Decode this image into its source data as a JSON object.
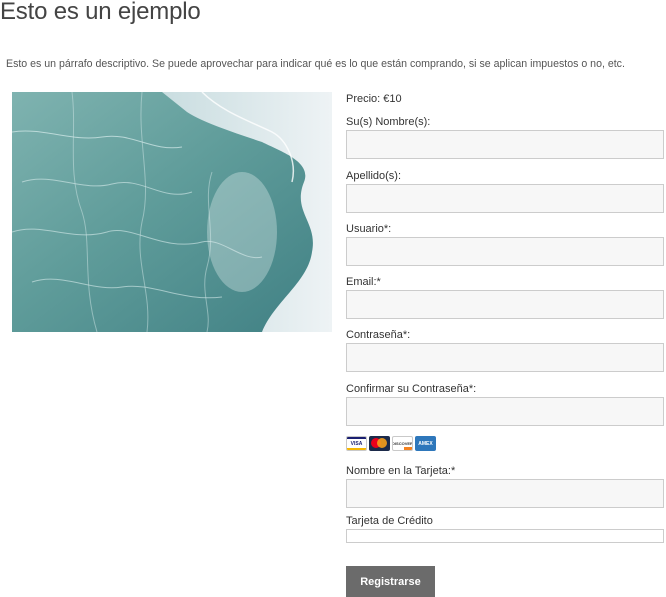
{
  "header": {
    "title": "Esto es un ejemplo",
    "description": "Esto es un párrafo descriptivo. Se puede aprovechar para indicar qué es lo que están comprando, si se aplican impuestos o no, etc."
  },
  "product": {
    "image_icon": "frozen-landscape-aerial-photo",
    "price": "Precio: €10"
  },
  "form": {
    "first_name": {
      "label": "Su(s) Nombre(s):",
      "value": "",
      "placeholder": ""
    },
    "last_name": {
      "label": "Apellido(s):",
      "value": "",
      "placeholder": ""
    },
    "username": {
      "label": "Usuario*:",
      "value": "",
      "placeholder": ""
    },
    "email": {
      "label": "Email:*",
      "value": "",
      "placeholder": ""
    },
    "password": {
      "label": "Contraseña*:",
      "value": "",
      "placeholder": ""
    },
    "confirm_password": {
      "label": "Confirmar su Contraseña*:",
      "value": "",
      "placeholder": ""
    },
    "cards": {
      "visa": "VISA",
      "mastercard": "mastercard-icon",
      "discover": "DISCOVER",
      "amex": "AMEX"
    },
    "card_name": {
      "label": "Nombre en la Tarjeta:*",
      "value": "",
      "placeholder": ""
    },
    "credit_card": {
      "label": "Tarjeta de Crédito",
      "value": "",
      "placeholder": ""
    },
    "submit_label": "Registrarse"
  },
  "colors": {
    "button_bg": "#6b6b6b",
    "input_bg": "#f7f7f7",
    "input_border": "#cccccc",
    "text": "#333333"
  }
}
